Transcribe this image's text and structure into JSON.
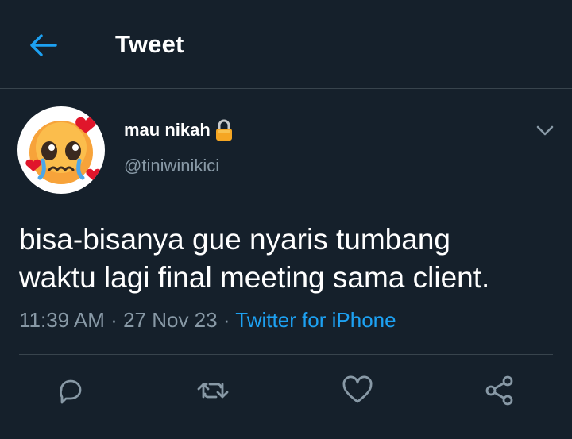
{
  "header": {
    "title": "Tweet",
    "back_icon": "arrow-left-icon"
  },
  "tweet": {
    "display_name": "mau nikah",
    "protected_icon": "lock-icon",
    "handle": "@tiniwinikici",
    "avatar": "pleading-face-with-hearts-avatar",
    "menu_icon": "chevron-down-icon",
    "text_line1": "bisa-bisanya gue nyaris tumbang",
    "text_line2": "waktu lagi final meeting sama client.",
    "time": "11:39 AM",
    "date": "27 Nov 23",
    "separator": "·",
    "source": "Twitter for iPhone"
  },
  "actions": [
    {
      "name": "reply",
      "icon": "reply-icon"
    },
    {
      "name": "retweet",
      "icon": "retweet-icon"
    },
    {
      "name": "like",
      "icon": "heart-icon"
    },
    {
      "name": "share",
      "icon": "share-icon"
    }
  ],
  "colors": {
    "background": "#15202b",
    "accent": "#1da1f2",
    "secondary_text": "#8899a6",
    "border": "#38444d"
  }
}
